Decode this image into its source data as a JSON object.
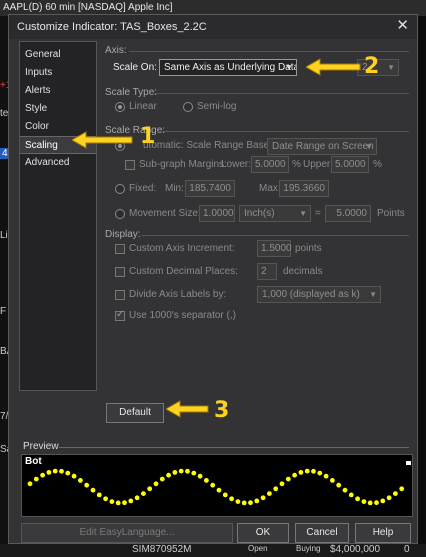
{
  "background": {
    "title": "AAPL(D) 60 min [NASDAQ] Apple Inc]",
    "left_labels": [
      "+19",
      "teg",
      "4",
      "Lic",
      "F",
      "BAT",
      "Save",
      "7/14"
    ],
    "bottom": {
      "account": "SIM870952M",
      "open_label": "Open",
      "buying_label": "Buying",
      "buying_value": "$4,000,000",
      "qty": "0"
    }
  },
  "dialog": {
    "title": "Customize Indicator: TAS_Boxes_2.2C",
    "close_glyph": "✕",
    "nav": {
      "items": [
        "General",
        "Inputs",
        "Alerts",
        "Style",
        "Color",
        "Scaling",
        "Advanced"
      ],
      "active_index": 5
    },
    "axis": {
      "section": "Axis:",
      "scale_on_label": "Scale On:",
      "scale_on_value": "Same Axis as Underlying Data",
      "subgraph_value": "2"
    },
    "scale_type": {
      "section": "Scale Type:",
      "linear": "Linear",
      "semilog": "Semi-log",
      "selected": "linear"
    },
    "scale_range": {
      "section": "Scale Range:",
      "automatic_label": "Automatic: Scale Range Based on:",
      "automatic_shown": "utomatic: Scale Range Based on:",
      "based_on": "Date Range on Screen",
      "subgraph_margins": "Sub-graph Margins:",
      "lower_label": "Lower:",
      "lower_value": "5.0000",
      "upper_label": "Upper:",
      "upper_value": "5.0000",
      "pct": "%",
      "fixed_label": "Fixed:",
      "min_label": "Min:",
      "min_value": "185.7400",
      "max_label": "Max:",
      "max_value": "195.3660",
      "movement_label": "Movement Size:",
      "movement_value": "1.0000",
      "movement_unit": "Inch(s)",
      "equals": "=",
      "points_value": "5.0000",
      "points_label": "Points"
    },
    "display": {
      "section": "Display:",
      "custom_axis_increment": "Custom Axis Increment:",
      "increment_value": "1.5000",
      "increment_unit": "points",
      "custom_decimal": "Custom Decimal Places:",
      "decimal_value": "2",
      "decimal_unit": "decimals",
      "divide_labels": "Divide Axis Labels by:",
      "divide_value": "1,000 (displayed as k)",
      "use_1000": "Use 1000's separator (,)",
      "use_1000_checked": true
    },
    "default_button": "Default",
    "preview": {
      "label": "Preview",
      "indicator_name": "Bot"
    },
    "buttons": {
      "edit": "Edit EasyLanguage...",
      "ok": "OK",
      "cancel": "Cancel",
      "help": "Help"
    }
  },
  "callouts": [
    "1",
    "2",
    "3"
  ],
  "colors": {
    "callout": "#ffd21f",
    "dots": "#ffff00"
  }
}
